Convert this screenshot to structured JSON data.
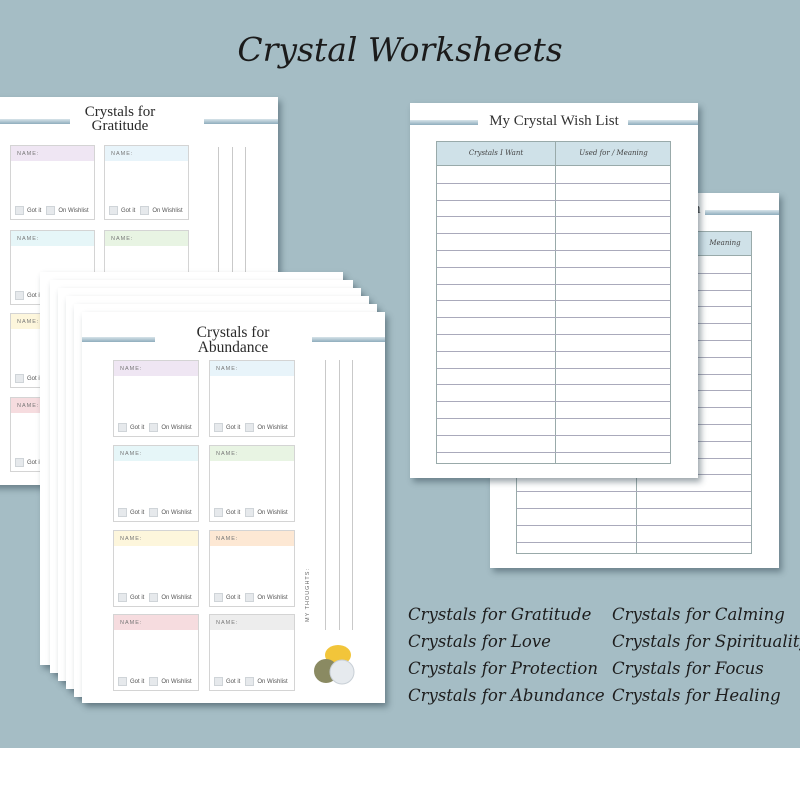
{
  "title": "Crystal Worksheets",
  "card_labels": {
    "name": "NAME:",
    "got_it": "Got it",
    "on_wishlist": "On Wishlist",
    "my_thoughts": "MY THOUGHTS:"
  },
  "gratitude_page": {
    "title_line1": "Crystals for",
    "title_line2": "Gratitude",
    "card_colors": [
      "#efe6f3",
      "#e8f4fa",
      "#e6f6f8",
      "#e8f4e3",
      "#fdf6dc",
      "#fde8d4",
      "#f6dcdf",
      "#ededed"
    ]
  },
  "abundance_page": {
    "title_line1": "Crystals for",
    "title_line2": "Abundance",
    "card_colors": [
      "#efe6f3",
      "#e8f4fa",
      "#e6f6f8",
      "#e8f4e3",
      "#fdf6dc",
      "#fde8d4",
      "#f6dcdf",
      "#ededed"
    ]
  },
  "wish_list": {
    "title": "My Crystal Wish List",
    "col1": "Crystals I Want",
    "col2": "Used for / Meaning",
    "header_color": "#cfe1e8"
  },
  "wish_list_back": {
    "title_fragment": "n",
    "col2_fragment": "Meaning"
  },
  "topics_left": [
    "Crystals for Gratitude",
    "Crystals for Love",
    "Crystals for Protection",
    "Crystals for Abundance"
  ],
  "topics_right": [
    "Crystals for Calming",
    "Crystals for Spirituality",
    "Crystals for Focus",
    "Crystals for Healing"
  ]
}
